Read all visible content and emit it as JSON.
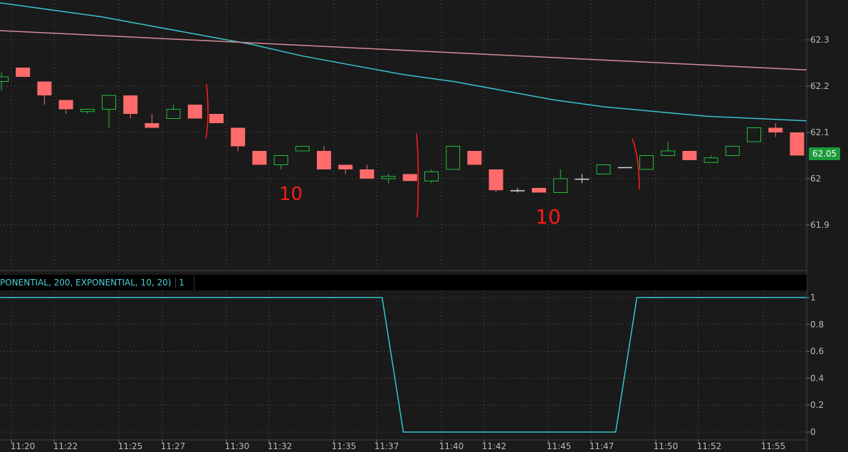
{
  "study": {
    "label": "PONENTIAL, 200, EXPONENTIAL, 10, 20)",
    "value": "1"
  },
  "last_price_label": "62.05",
  "colors": {
    "background": "#1a1a1a",
    "grid": "#5a5a5a",
    "up_candle": "#22c03c",
    "down_candle": "#ff6b6b",
    "doji": "#d9d9d9",
    "ema_fast": "#39c4cf",
    "ema_slow": "#d88b96",
    "study_line": "#37c6d2",
    "annotation": "#ff1a1a",
    "last_price_badge": "#1b9c3a"
  },
  "chart_data": [
    {
      "type": "candlestick",
      "panel": "price",
      "x_labels": [
        "11:20",
        "11:22",
        "11:25",
        "11:27",
        "11:30",
        "11:32",
        "11:35",
        "11:37",
        "11:40",
        "11:42",
        "11:45",
        "11:47",
        "11:50",
        "11:52",
        "11:55"
      ],
      "y_ticks": [
        61.9,
        62,
        62.1,
        62.2,
        62.3
      ],
      "y_tick_labels": [
        "61.9",
        "62",
        "62.1",
        "62.2",
        "62.3"
      ],
      "ylim": [
        61.8,
        62.38
      ],
      "grid": true,
      "candles": [
        {
          "o": 62.21,
          "h": 62.23,
          "l": 62.19,
          "c": 62.22
        },
        {
          "o": 62.24,
          "h": 62.24,
          "l": 62.22,
          "c": 62.22
        },
        {
          "o": 62.21,
          "h": 62.21,
          "l": 62.16,
          "c": 62.18
        },
        {
          "o": 62.17,
          "h": 62.17,
          "l": 62.14,
          "c": 62.15
        },
        {
          "o": 62.145,
          "h": 62.15,
          "l": 62.14,
          "c": 62.15
        },
        {
          "o": 62.15,
          "h": 62.18,
          "l": 62.11,
          "c": 62.18
        },
        {
          "o": 62.18,
          "h": 62.18,
          "l": 62.13,
          "c": 62.14
        },
        {
          "o": 62.12,
          "h": 62.14,
          "l": 62.11,
          "c": 62.11
        },
        {
          "o": 62.13,
          "h": 62.16,
          "l": 62.13,
          "c": 62.15
        },
        {
          "o": 62.16,
          "h": 62.16,
          "l": 62.13,
          "c": 62.13
        },
        {
          "o": 62.14,
          "h": 62.14,
          "l": 62.12,
          "c": 62.12
        },
        {
          "o": 62.11,
          "h": 62.11,
          "l": 62.06,
          "c": 62.07
        },
        {
          "o": 62.06,
          "h": 62.06,
          "l": 62.03,
          "c": 62.03
        },
        {
          "o": 62.03,
          "h": 62.05,
          "l": 62.02,
          "c": 62.05
        },
        {
          "o": 62.06,
          "h": 62.07,
          "l": 62.06,
          "c": 62.07
        },
        {
          "o": 62.06,
          "h": 62.07,
          "l": 62.02,
          "c": 62.02
        },
        {
          "o": 62.03,
          "h": 62.03,
          "l": 62.01,
          "c": 62.02
        },
        {
          "o": 62.02,
          "h": 62.03,
          "l": 62.0,
          "c": 62.0
        },
        {
          "o": 62.0,
          "h": 62.01,
          "l": 61.99,
          "c": 62.005
        },
        {
          "o": 62.01,
          "h": 62.01,
          "l": 61.995,
          "c": 61.995
        },
        {
          "o": 61.995,
          "h": 62.02,
          "l": 61.99,
          "c": 62.015
        },
        {
          "o": 62.02,
          "h": 62.07,
          "l": 62.02,
          "c": 62.07
        },
        {
          "o": 62.06,
          "h": 62.06,
          "l": 62.03,
          "c": 62.03
        },
        {
          "o": 62.02,
          "h": 62.02,
          "l": 61.97,
          "c": 61.975
        },
        {
          "o": 61.975,
          "h": 61.98,
          "l": 61.97,
          "c": 61.975
        },
        {
          "o": 61.98,
          "h": 61.98,
          "l": 61.97,
          "c": 61.97
        },
        {
          "o": 61.97,
          "h": 62.02,
          "l": 61.97,
          "c": 62.0
        },
        {
          "o": 62.0,
          "h": 62.01,
          "l": 61.99,
          "c": 62.0
        },
        {
          "o": 62.01,
          "h": 62.03,
          "l": 62.01,
          "c": 62.03
        },
        {
          "o": 62.025,
          "h": 62.025,
          "l": 62.025,
          "c": 62.025
        },
        {
          "o": 62.02,
          "h": 62.05,
          "l": 62.02,
          "c": 62.05
        },
        {
          "o": 62.05,
          "h": 62.08,
          "l": 62.05,
          "c": 62.06
        },
        {
          "o": 62.06,
          "h": 62.06,
          "l": 62.04,
          "c": 62.04
        },
        {
          "o": 62.035,
          "h": 62.05,
          "l": 62.035,
          "c": 62.045
        },
        {
          "o": 62.05,
          "h": 62.07,
          "l": 62.05,
          "c": 62.07
        },
        {
          "o": 62.08,
          "h": 62.11,
          "l": 62.08,
          "c": 62.11
        },
        {
          "o": 62.11,
          "h": 62.12,
          "l": 62.09,
          "c": 62.1
        },
        {
          "o": 62.1,
          "h": 62.1,
          "l": 62.05,
          "c": 62.05
        }
      ],
      "series": [
        {
          "values": [
            62.38,
            62.365,
            62.35,
            62.33,
            62.31,
            62.29,
            62.265,
            62.245,
            62.225,
            62.21,
            62.19,
            62.17,
            62.155,
            62.145,
            62.135,
            62.13,
            62.125
          ]
        },
        {
          "values": [
            62.32,
            62.315,
            62.31,
            62.305,
            62.3,
            62.295,
            62.29,
            62.285,
            62.28,
            62.275,
            62.27,
            62.265,
            62.26,
            62.255,
            62.25,
            62.245,
            62.24,
            62.235
          ]
        }
      ],
      "annotations": [
        "10",
        "10"
      ]
    },
    {
      "type": "line",
      "panel": "study",
      "y_ticks": [
        0,
        0.2,
        0.4,
        0.6,
        0.8,
        1
      ],
      "y_tick_labels": [
        "0",
        "0.2",
        "0.4",
        "0.6",
        "0.8",
        "1"
      ],
      "ylim": [
        -0.03,
        1.03
      ],
      "grid": true,
      "values": [
        1,
        1,
        1,
        1,
        1,
        1,
        1,
        1,
        1,
        1,
        1,
        1,
        1,
        1,
        1,
        1,
        1,
        1,
        1,
        0,
        0,
        0,
        0,
        0,
        0,
        0,
        0,
        0,
        0,
        0,
        1,
        1,
        1,
        1,
        1,
        1,
        1,
        1,
        1
      ]
    }
  ]
}
